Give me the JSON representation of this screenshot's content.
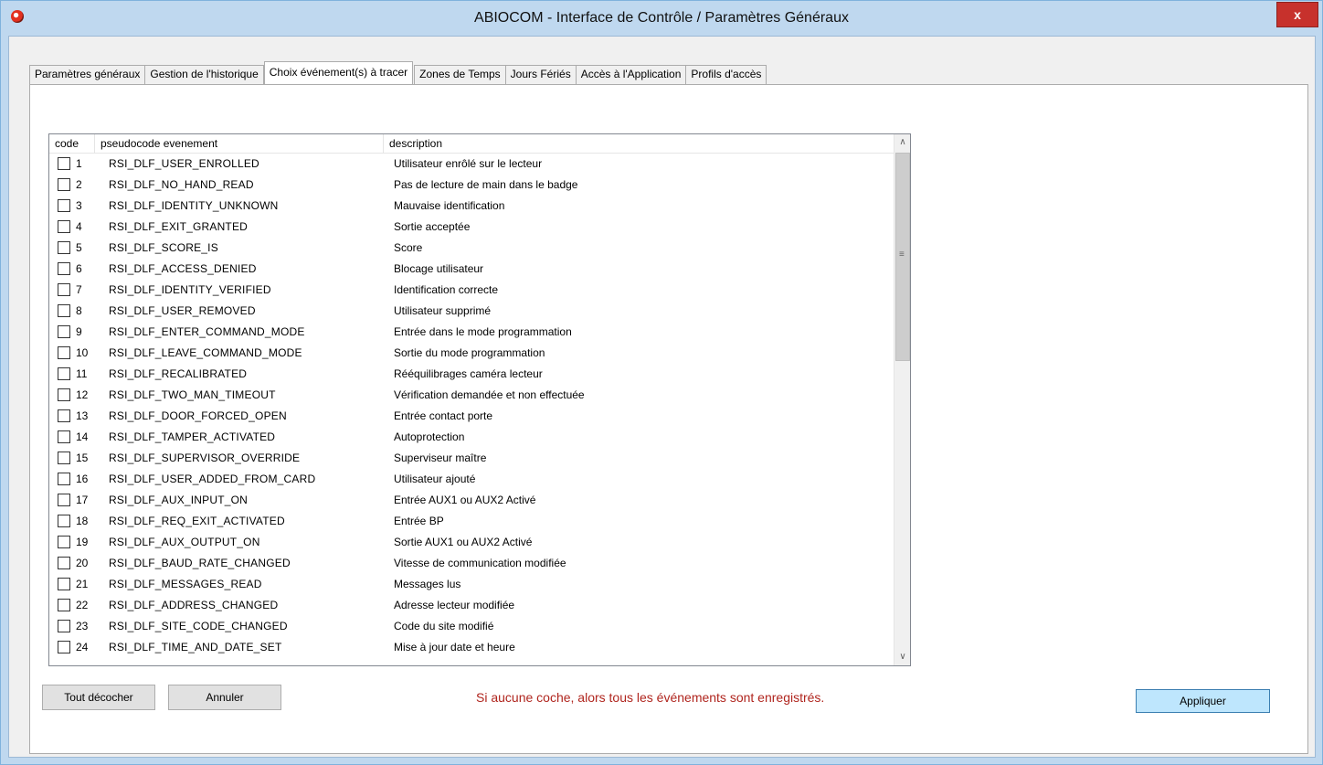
{
  "window": {
    "title": "ABIOCOM - Interface de Contrôle / Paramètres Généraux",
    "close_label": "x",
    "app_icon": "abiocom-app-icon"
  },
  "tabs": [
    {
      "label": "Paramètres généraux",
      "active": false
    },
    {
      "label": "Gestion de l'historique",
      "active": false
    },
    {
      "label": "Choix événement(s) à tracer",
      "active": true
    },
    {
      "label": "Zones de Temps",
      "active": false
    },
    {
      "label": "Jours Fériés",
      "active": false
    },
    {
      "label": "Accès à l'Application",
      "active": false
    },
    {
      "label": "Profils d'accès",
      "active": false
    }
  ],
  "events_list": {
    "columns": {
      "code": "code",
      "pseudocode": "pseudocode evenement",
      "description": "description"
    },
    "rows": [
      {
        "code": "1",
        "pseudocode": "RSI_DLF_USER_ENROLLED",
        "description": "Utilisateur enrôlé sur le lecteur",
        "checked": false
      },
      {
        "code": "2",
        "pseudocode": "RSI_DLF_NO_HAND_READ",
        "description": "Pas de lecture de  main dans le badge",
        "checked": false
      },
      {
        "code": "3",
        "pseudocode": "RSI_DLF_IDENTITY_UNKNOWN",
        "description": "Mauvaise identification",
        "checked": false
      },
      {
        "code": "4",
        "pseudocode": "RSI_DLF_EXIT_GRANTED",
        "description": "Sortie acceptée",
        "checked": false
      },
      {
        "code": "5",
        "pseudocode": "RSI_DLF_SCORE_IS",
        "description": "Score",
        "checked": false
      },
      {
        "code": "6",
        "pseudocode": "RSI_DLF_ACCESS_DENIED",
        "description": "Blocage utilisateur",
        "checked": false
      },
      {
        "code": "7",
        "pseudocode": "RSI_DLF_IDENTITY_VERIFIED",
        "description": "Identification correcte",
        "checked": false
      },
      {
        "code": "8",
        "pseudocode": "RSI_DLF_USER_REMOVED",
        "description": "Utilisateur supprimé",
        "checked": false
      },
      {
        "code": "9",
        "pseudocode": "RSI_DLF_ENTER_COMMAND_MODE",
        "description": "Entrée dans le mode programmation",
        "checked": false
      },
      {
        "code": "10",
        "pseudocode": "RSI_DLF_LEAVE_COMMAND_MODE",
        "description": "Sortie du mode programmation",
        "checked": false
      },
      {
        "code": "11",
        "pseudocode": "RSI_DLF_RECALIBRATED",
        "description": "Rééquilibrages caméra lecteur",
        "checked": false
      },
      {
        "code": "12",
        "pseudocode": "RSI_DLF_TWO_MAN_TIMEOUT",
        "description": "Vérification demandée et non effectuée",
        "checked": false
      },
      {
        "code": "13",
        "pseudocode": "RSI_DLF_DOOR_FORCED_OPEN",
        "description": "Entrée contact porte",
        "checked": false
      },
      {
        "code": "14",
        "pseudocode": "RSI_DLF_TAMPER_ACTIVATED",
        "description": "Autoprotection",
        "checked": false
      },
      {
        "code": "15",
        "pseudocode": "RSI_DLF_SUPERVISOR_OVERRIDE",
        "description": "Superviseur maître",
        "checked": false
      },
      {
        "code": "16",
        "pseudocode": "RSI_DLF_USER_ADDED_FROM_CARD",
        "description": "Utilisateur ajouté",
        "checked": false
      },
      {
        "code": "17",
        "pseudocode": "RSI_DLF_AUX_INPUT_ON",
        "description": "Entrée AUX1 ou AUX2 Activé",
        "checked": false
      },
      {
        "code": "18",
        "pseudocode": "RSI_DLF_REQ_EXIT_ACTIVATED",
        "description": "Entrée BP",
        "checked": false
      },
      {
        "code": "19",
        "pseudocode": "RSI_DLF_AUX_OUTPUT_ON",
        "description": "Sortie AUX1 ou AUX2 Activé",
        "checked": false
      },
      {
        "code": "20",
        "pseudocode": "RSI_DLF_BAUD_RATE_CHANGED",
        "description": "Vitesse de communication modifiée",
        "checked": false
      },
      {
        "code": "21",
        "pseudocode": "RSI_DLF_MESSAGES_READ",
        "description": "Messages lus",
        "checked": false
      },
      {
        "code": "22",
        "pseudocode": "RSI_DLF_ADDRESS_CHANGED",
        "description": "Adresse lecteur modifiée",
        "checked": false
      },
      {
        "code": "23",
        "pseudocode": "RSI_DLF_SITE_CODE_CHANGED",
        "description": "Code du site modifié",
        "checked": false
      },
      {
        "code": "24",
        "pseudocode": "RSI_DLF_TIME_AND_DATE_SET",
        "description": "Mise à jour date et heure",
        "checked": false
      }
    ],
    "scroll_up_icon": "chevron-up-icon",
    "scroll_down_icon": "chevron-down-icon",
    "scroll_grip_icon": "grip-icon"
  },
  "buttons": {
    "uncheck_all": "Tout décocher",
    "cancel": "Annuler",
    "apply": "Appliquer"
  },
  "note": "Si aucune coche, alors tous les événements sont enregistrés.",
  "colors": {
    "note_text": "#b0251e",
    "close_button": "#c7312c",
    "window_frame": "#bfd8ef",
    "apply_button": "#bee6fd"
  }
}
